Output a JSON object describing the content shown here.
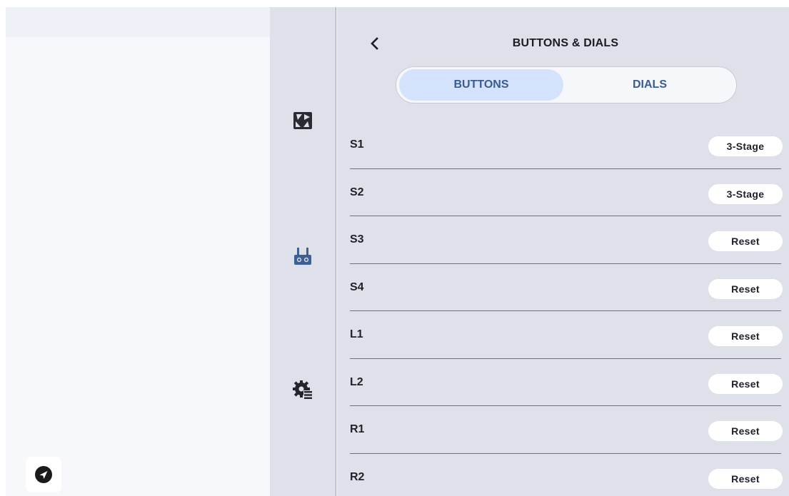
{
  "header": {
    "back_icon": "chevron-left-icon",
    "title": "BUTTONS & DIALS"
  },
  "tabs": [
    {
      "label": "BUTTONS",
      "active": true
    },
    {
      "label": "DIALS",
      "active": false
    }
  ],
  "rail": {
    "items": [
      {
        "icon": "camera-shutter-icon"
      },
      {
        "icon": "remote-controller-icon",
        "active": true
      },
      {
        "icon": "settings-list-icon"
      }
    ]
  },
  "left_panel": {
    "fab_icon": "send-arrow-icon"
  },
  "rows": [
    {
      "label": "S1",
      "value": "3-Stage"
    },
    {
      "label": "S2",
      "value": "3-Stage"
    },
    {
      "label": "S3",
      "value": "Reset"
    },
    {
      "label": "S4",
      "value": "Reset"
    },
    {
      "label": "L1",
      "value": "Reset"
    },
    {
      "label": "L2",
      "value": "Reset"
    },
    {
      "label": "R1",
      "value": "Reset"
    },
    {
      "label": "R2",
      "value": "Reset"
    }
  ],
  "colors": {
    "accent": "#3b5c8f",
    "tab_active_bg": "#d4e3fb",
    "panel_bg": "#dfe1ea",
    "rail_active_icon": "#3e5f93"
  }
}
